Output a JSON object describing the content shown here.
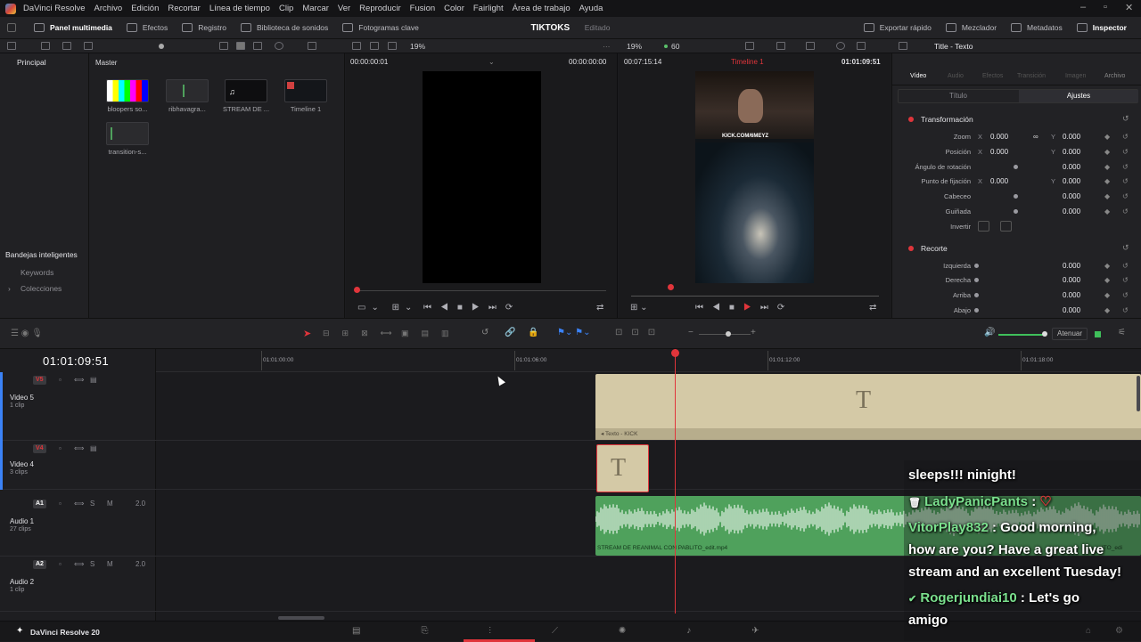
{
  "menubar": {
    "app": "DaVinci Resolve",
    "items": [
      "Archivo",
      "Edición",
      "Recortar",
      "Línea de tiempo",
      "Clip",
      "Marcar",
      "Ver",
      "Reproducir",
      "Fusion",
      "Color",
      "Fairlight",
      "Área de trabajo",
      "Ayuda"
    ]
  },
  "toolbar": {
    "left": [
      "Panel multimedia",
      "Efectos",
      "Registro",
      "Biblioteca de sonidos",
      "Fotogramas clave"
    ],
    "project_name": "TIKTOKS",
    "project_status": "Editado",
    "right": [
      "Exportar rápido",
      "Mezclador",
      "Metadatos",
      "Inspector"
    ]
  },
  "subbar": {
    "zoom_left": "19%",
    "zoom_right": "19%",
    "fps": "60",
    "inspector_title": "Title - Texto"
  },
  "left_panel": {
    "bin": "Principal",
    "smart_bins": "Bandejas inteligentes",
    "items": [
      "Keywords",
      "Colecciones"
    ]
  },
  "media": {
    "header": "Master",
    "clips": [
      "bloopers so...",
      "ribhavagra...",
      "STREAM DE ...",
      "Timeline 1",
      "transition-s..."
    ]
  },
  "source_viewer": {
    "timecode": "00:00:00:01",
    "duration": "00:00:00:00"
  },
  "timeline_viewer": {
    "timecode": "00:07:15:14",
    "name": "Timeline 1",
    "position": "01:01:09:51",
    "overlay": "KICK.COM/6MEYZ"
  },
  "inspector": {
    "tabs": [
      "Vídeo",
      "Audio",
      "Efectos",
      "Transición",
      "Imagen",
      "Archivo"
    ],
    "subtabs": [
      "Título",
      "Ajustes"
    ],
    "sections": [
      {
        "title": "Transformación",
        "rows": [
          {
            "label": "Zoom",
            "x": "0.000",
            "y": "0.000"
          },
          {
            "label": "Posición",
            "x": "0.000",
            "y": "0.000"
          },
          {
            "label": "Ángulo de rotación",
            "v": "0.000"
          },
          {
            "label": "Punto de fijación",
            "x": "0.000",
            "y": "0.000"
          },
          {
            "label": "Cabeceo",
            "v": "0.000"
          },
          {
            "label": "Guiñada",
            "v": "0.000"
          },
          {
            "label": "Invertir"
          }
        ]
      },
      {
        "title": "Recorte",
        "rows": [
          {
            "label": "Izquierda",
            "v": "0.000"
          },
          {
            "label": "Derecha",
            "v": "0.000"
          },
          {
            "label": "Arriba",
            "v": "0.000"
          },
          {
            "label": "Abajo",
            "v": "0.000"
          }
        ]
      }
    ]
  },
  "timeline": {
    "timecode": "01:01:09:51",
    "ruler": [
      "01:01:00:00",
      "01:01:06:00",
      "01:01:12:00",
      "01:01:18:00"
    ],
    "tracks": [
      {
        "tag": "V5",
        "name": "Video 5",
        "count": "1 clip"
      },
      {
        "tag": "V4",
        "name": "Video 4",
        "count": "3 clips"
      },
      {
        "tag": "A1",
        "name": "Audio 1",
        "count": "27 clips",
        "level": "2.0"
      },
      {
        "tag": "A2",
        "name": "Audio 2",
        "count": "1 clip",
        "level": "2.0"
      }
    ],
    "clip_v5": "Texto - KICK",
    "clip_a1": "STREAM DE REANIMAL CON PABLITO_edit.mp4",
    "clip_a1_right": "ITO_edi",
    "clip_text_glyph": "T",
    "mute_label": "Atenuar"
  },
  "statusbar": {
    "app": "DaVinci Resolve 20"
  },
  "chat": {
    "line1": "sleeps!!! ninight!",
    "user2": "LadyPanicPants",
    "user3": "VitorPlay832",
    "msg3a": " : Good morning,",
    "msg3b": "how are you? Have a great live",
    "msg3c": "stream and an excellent Tuesday!",
    "user4": "Rogerjundiai10",
    "msg4a": " : Let's go",
    "msg4b": "amigo",
    "sep": " :"
  },
  "colors": {
    "accent": "#e0353b",
    "clip_text": "#d4c9a6",
    "clip_audio": "#4fa15c",
    "chat_green": "#7be08e"
  }
}
